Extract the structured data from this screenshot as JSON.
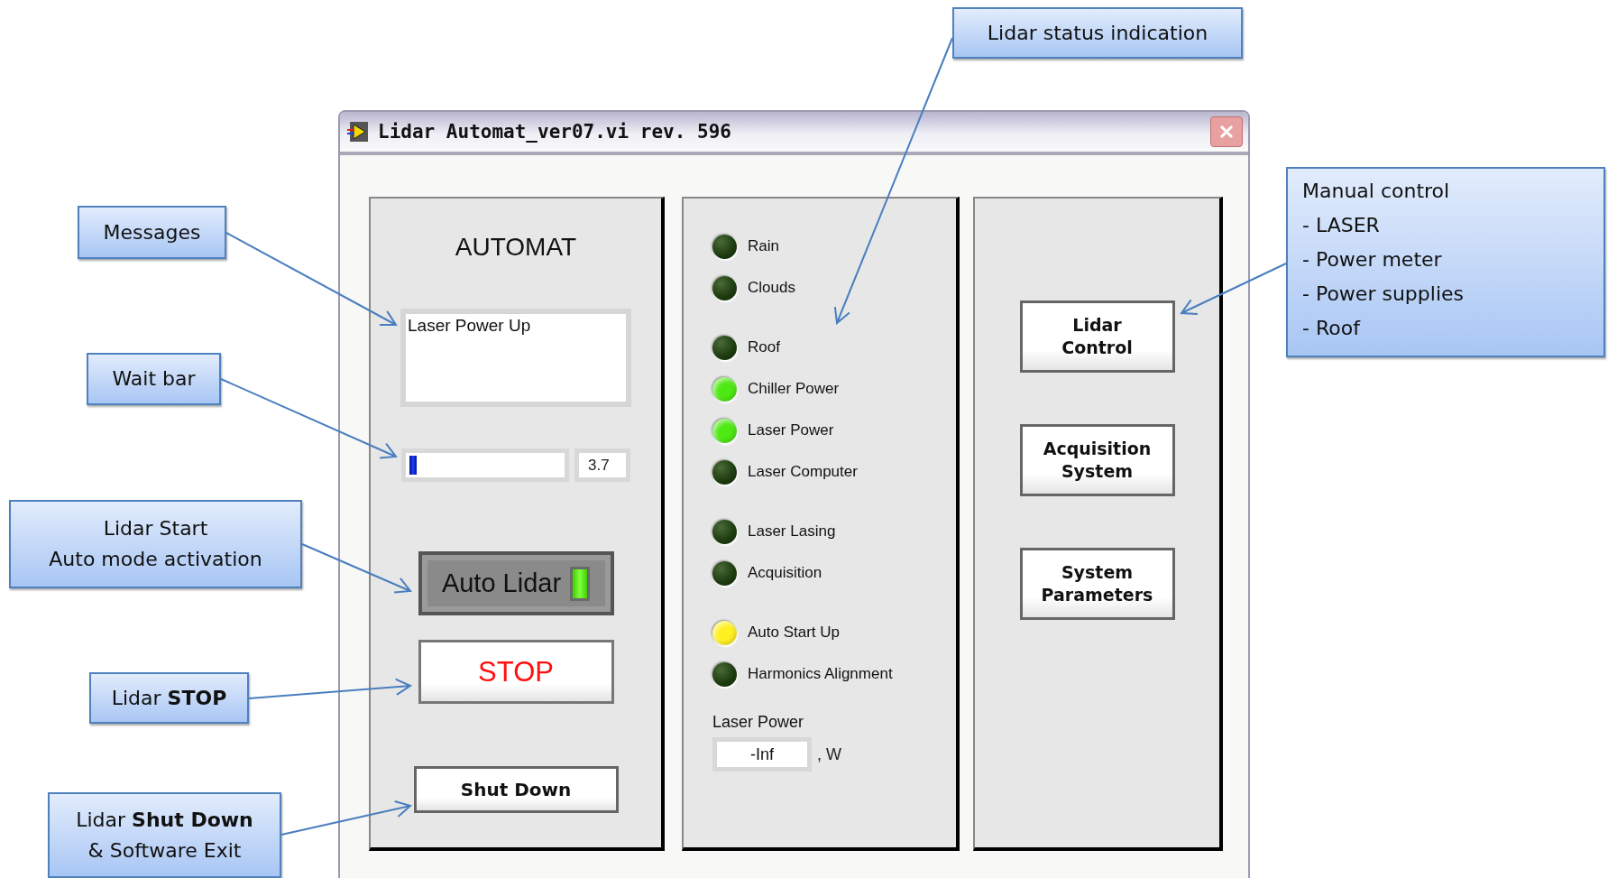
{
  "window": {
    "title": "Lidar Automat_ver07.vi rev. 596"
  },
  "automat": {
    "heading": "AUTOMAT",
    "messages": {
      "value": "Laser Power Up"
    },
    "wait_bar": {
      "level": 0.05,
      "reading": "3.7"
    },
    "auto_lidar": {
      "label": "Auto Lidar",
      "on": true
    },
    "stop": {
      "label": "STOP"
    },
    "shut_down": {
      "label": "Shut Down"
    }
  },
  "status": {
    "groups": [
      {
        "indicators": [
          {
            "label": "Rain",
            "on": false
          },
          {
            "label": "Clouds",
            "on": false
          }
        ]
      },
      {
        "indicators": [
          {
            "label": "Roof",
            "on": false
          },
          {
            "label": "Chiller Power",
            "on": true,
            "color": "#4ee812"
          },
          {
            "label": "Laser Power",
            "on": true,
            "color": "#4ee812"
          },
          {
            "label": "Laser Computer",
            "on": false
          }
        ]
      },
      {
        "indicators": [
          {
            "label": "Laser Lasing",
            "on": false
          },
          {
            "label": "Acquisition",
            "on": false
          }
        ]
      },
      {
        "indicators": [
          {
            "label": "Auto Start Up",
            "on": true,
            "color": "#fff020"
          },
          {
            "label": "Harmonics Alignment",
            "on": false
          }
        ]
      }
    ],
    "laser_power": {
      "label": "Laser Power",
      "value": "-Inf",
      "unit": ", W"
    }
  },
  "manual": {
    "buttons": [
      "Lidar\nControl",
      "Acquisition\nSystem",
      "System\nParameters"
    ]
  },
  "callouts": [
    {
      "lines": [
        "Lidar status indication"
      ]
    },
    {
      "lines": [
        "Messages"
      ]
    },
    {
      "lines": [
        "Manual control",
        "- LASER",
        "- Power meter",
        "- Power supplies",
        "- Roof"
      ]
    },
    {
      "lines": [
        "Wait bar"
      ]
    },
    {
      "lines": [
        "Lidar Start",
        "Auto mode activation"
      ]
    },
    {
      "lines": [
        "Lidar **STOP**"
      ]
    },
    {
      "lines": [
        "Lidar **Shut Down**",
        "& Software Exit"
      ]
    }
  ]
}
